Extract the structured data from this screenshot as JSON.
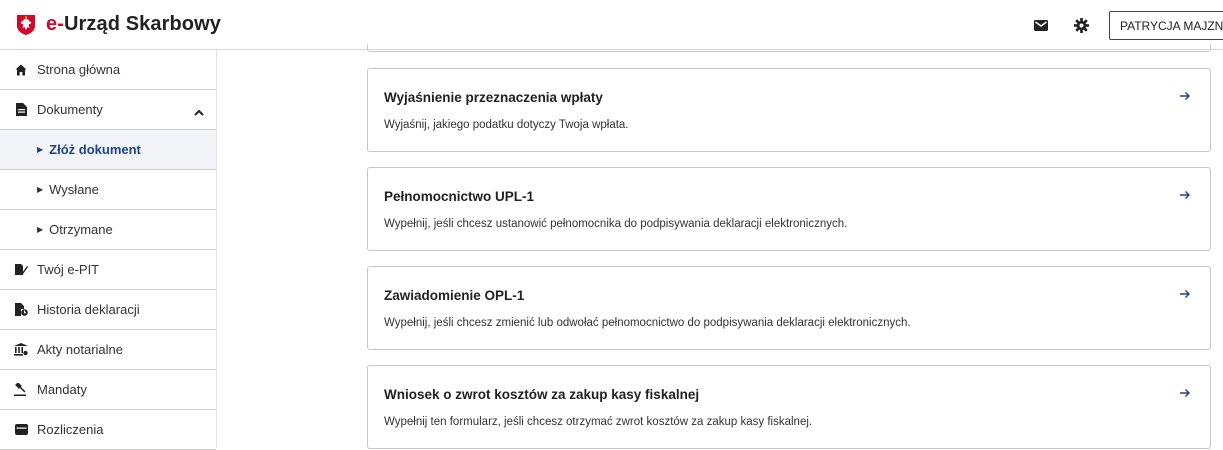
{
  "header": {
    "brand_e": "e-",
    "brand_rest": "Urząd Skarbowy",
    "user_label": "PATRYCJA MAJZNER"
  },
  "sidebar": {
    "items": [
      {
        "label": "Strona główna",
        "icon": "home-icon"
      },
      {
        "label": "Dokumenty",
        "icon": "document-icon"
      },
      {
        "label": "Złóż dokument",
        "icon": "triangle-right-icon"
      },
      {
        "label": "Wysłane",
        "icon": "triangle-right-icon"
      },
      {
        "label": "Otrzymane",
        "icon": "triangle-right-icon"
      },
      {
        "label": "Twój e-PIT",
        "icon": "pen-document-icon"
      },
      {
        "label": "Historia deklaracji",
        "icon": "document-history-icon"
      },
      {
        "label": "Akty notarialne",
        "icon": "notary-icon"
      },
      {
        "label": "Mandaty",
        "icon": "gavel-icon"
      },
      {
        "label": "Rozliczenia",
        "icon": "wallet-icon"
      }
    ]
  },
  "cards": [
    {
      "title": "Wyjaśnienie przeznaczenia wpłaty",
      "desc": "Wyjaśnij, jakiego podatku dotyczy Twoja wpłata."
    },
    {
      "title": "Pełnomocnictwo UPL-1",
      "desc": "Wypełnij, jeśli chcesz ustanowić pełnomocnika do podpisywania deklaracji elektronicznych."
    },
    {
      "title": "Zawiadomienie OPL-1",
      "desc": "Wypełnij, jeśli chcesz zmienić lub odwołać pełnomocnictwo do podpisywania deklaracji elektronicznych."
    },
    {
      "title": "Wniosek o zwrot kosztów za zakup kasy fiskalnej",
      "desc": "Wypełnij ten formularz, jeśli chcesz otrzymać zwrot kosztów za zakup kasy fiskalnej."
    }
  ],
  "colors": {
    "accent": "#1e4488",
    "brand_red": "#d10a2b"
  }
}
